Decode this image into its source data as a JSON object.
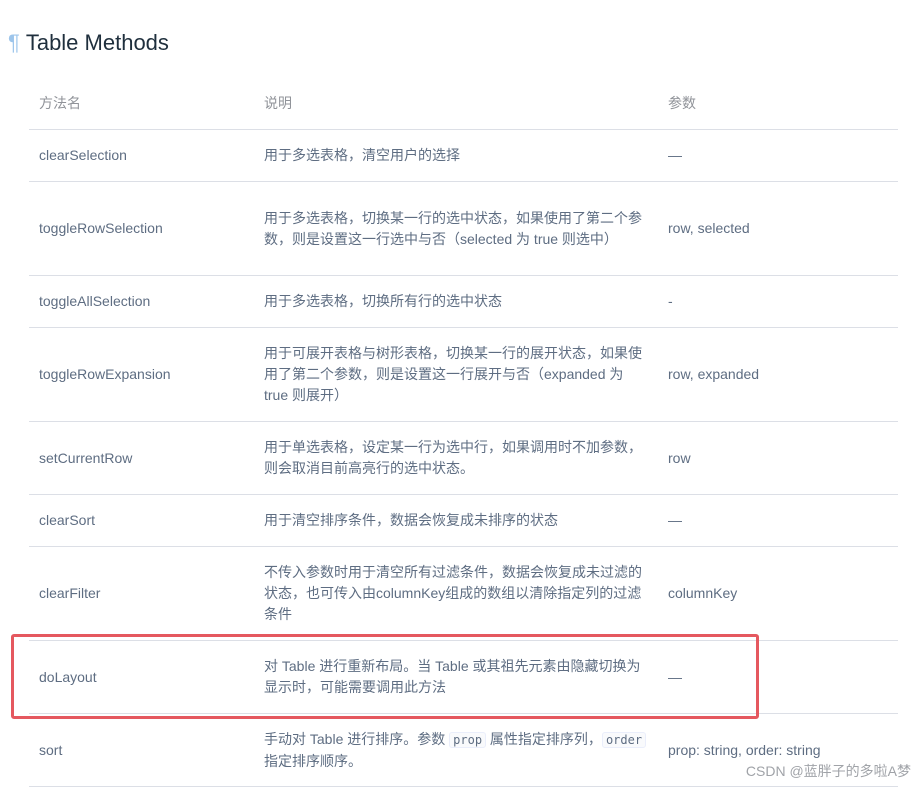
{
  "heading": {
    "anchor": "¶",
    "title": "Table Methods"
  },
  "table": {
    "headers": [
      "方法名",
      "说明",
      "参数"
    ],
    "rows": [
      {
        "name": "clearSelection",
        "desc": "用于多选表格，清空用户的选择",
        "param": "—"
      },
      {
        "name": "toggleRowSelection",
        "desc": "用于多选表格，切换某一行的选中状态，如果使用了第二个参数，则是设置这一行选中与否（selected 为 true 则选中）",
        "param": "row, selected"
      },
      {
        "name": "toggleAllSelection",
        "desc": "用于多选表格，切换所有行的选中状态",
        "param": "-"
      },
      {
        "name": "toggleRowExpansion",
        "desc": "用于可展开表格与树形表格，切换某一行的展开状态，如果使用了第二个参数，则是设置这一行展开与否（expanded 为 true 则展开）",
        "param": "row, expanded"
      },
      {
        "name": "setCurrentRow",
        "desc": "用于单选表格，设定某一行为选中行，如果调用时不加参数，则会取消目前高亮行的选中状态。",
        "param": "row"
      },
      {
        "name": "clearSort",
        "desc": "用于清空排序条件，数据会恢复成未排序的状态",
        "param": "—"
      },
      {
        "name": "clearFilter",
        "desc": "不传入参数时用于清空所有过滤条件，数据会恢复成未过滤的状态，也可传入由columnKey组成的数组以清除指定列的过滤条件",
        "param": "columnKey"
      },
      {
        "name": "doLayout",
        "desc": "对 Table 进行重新布局。当 Table 或其祖先元素由隐藏切换为显示时，可能需要调用此方法",
        "param": "—"
      },
      {
        "name": "sort",
        "desc_parts": [
          "手动对 Table 进行排序。参数 ",
          "prop",
          " 属性指定排序列，",
          "order",
          " 指定排序顺序。"
        ],
        "param": "prop: string, order: string"
      }
    ]
  },
  "watermark": "CSDN @蓝胖子的多啦A梦",
  "colors": {
    "highlight_border": "#e5585f",
    "heading_text": "#1f2f3d",
    "cell_text": "#5e6d82",
    "header_text": "#909399",
    "row_border": "#dcdfe6"
  }
}
